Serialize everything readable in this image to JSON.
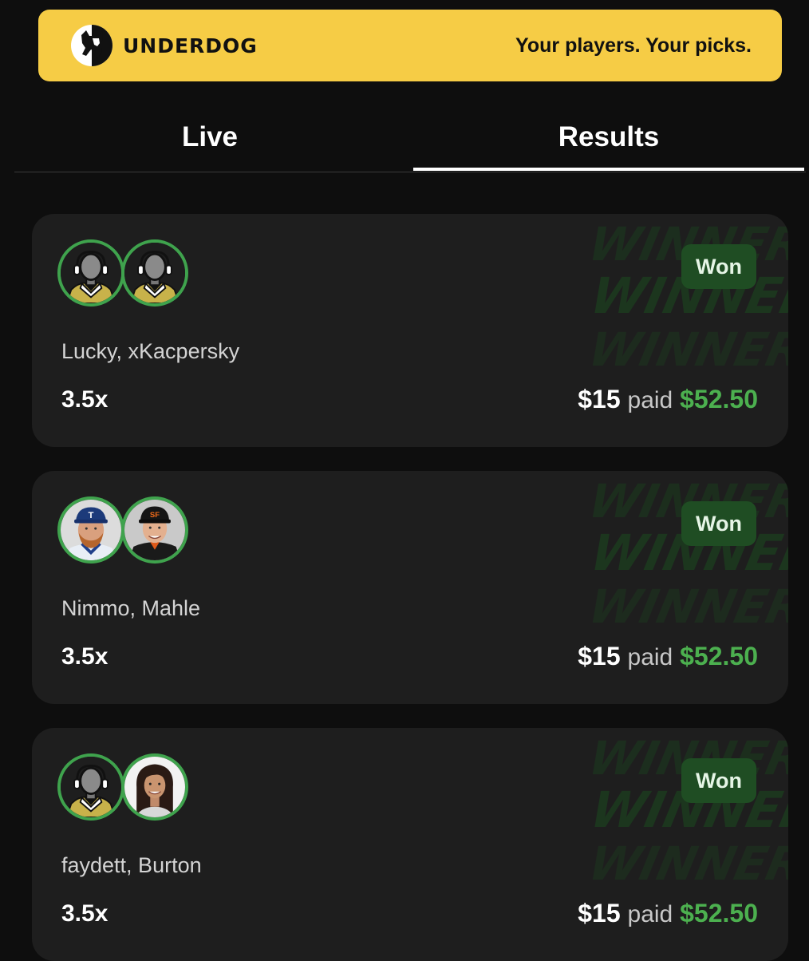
{
  "banner": {
    "brand": "UNDERDOG",
    "tagline": "Your players. Your picks.",
    "color": "#f6cc45"
  },
  "tabs": [
    {
      "label": "Live",
      "active": false
    },
    {
      "label": "Results",
      "active": true
    }
  ],
  "entries": [
    {
      "players": "Lucky, xKacpersky",
      "multiplier": "3.5x",
      "status": "Won",
      "entry_amount": "$15",
      "paid_label": "paid",
      "payout": "$52.50",
      "avatars": [
        "placeholder-player",
        "placeholder-player"
      ]
    },
    {
      "players": "Nimmo, Mahle",
      "multiplier": "3.5x",
      "status": "Won",
      "entry_amount": "$15",
      "paid_label": "paid",
      "payout": "$52.50",
      "avatars": [
        "player-photo-rangers",
        "player-photo-giants"
      ]
    },
    {
      "players": "faydett, Burton",
      "multiplier": "3.5x",
      "status": "Won",
      "entry_amount": "$15",
      "paid_label": "paid",
      "payout": "$52.50",
      "avatars": [
        "placeholder-player",
        "player-photo-woman"
      ]
    }
  ],
  "colors": {
    "won_green": "#4cb04f",
    "avatar_ring": "#3fa34d",
    "card_bg": "#1e1e1e"
  }
}
